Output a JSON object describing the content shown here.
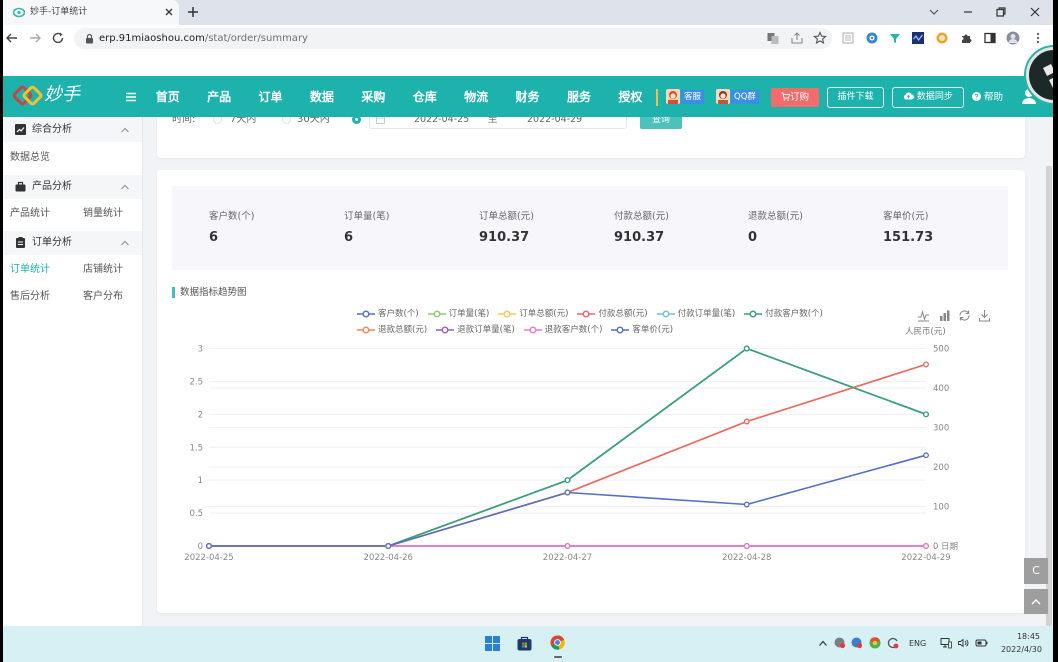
{
  "browser": {
    "tab_title": "妙手-订单统计",
    "url_host": "erp.91miaoshou.com",
    "url_path": "/stat/order/summary"
  },
  "colors": {
    "brand": "#1db3ac",
    "order_button": "#f26c6c",
    "chip_blue": "#3a8ee6",
    "nav_separator": "#e8c15a",
    "active_sidebar_item": "#1db3ac"
  },
  "nav": {
    "logo_text": "妙手",
    "items": [
      "首页",
      "产品",
      "订单",
      "数据",
      "采购",
      "仓库",
      "物流",
      "财务",
      "服务",
      "授权"
    ],
    "service_label": "客服",
    "qq_group_label": "QQ群",
    "order_label": "订购",
    "plugin_download_label": "插件下载",
    "data_sync_label": "数据同步",
    "help_label": "帮助"
  },
  "sidebar": {
    "sections": [
      {
        "title": "综合分析",
        "items": [
          "数据总览"
        ]
      },
      {
        "title": "产品分析",
        "items": [
          "产品统计",
          "销量统计"
        ]
      },
      {
        "title": "订单分析",
        "items": [
          "订单统计",
          "店铺统计",
          "售后分析",
          "客户分布"
        ]
      }
    ],
    "active_item": "订单统计"
  },
  "filter": {
    "time_label": "时间:",
    "options": [
      "7天内",
      "30天内"
    ],
    "selected": "custom-range",
    "start_date": "2022-04-25",
    "range_separator": "至",
    "end_date": "2022-04-29",
    "query_label": "查询"
  },
  "stats": [
    {
      "label": "客户数(个)",
      "value": "6"
    },
    {
      "label": "订单量(笔)",
      "value": "6"
    },
    {
      "label": "订单总额(元)",
      "value": "910.37"
    },
    {
      "label": "付款总额(元)",
      "value": "910.37"
    },
    {
      "label": "退款总额(元)",
      "value": "0"
    },
    {
      "label": "客单价(元)",
      "value": "151.73"
    }
  ],
  "chart_toolbox": [
    "line-chart-icon",
    "bar-chart-icon",
    "restore-icon",
    "download-icon"
  ],
  "chart_data": {
    "type": "line",
    "title": "数据指标趋势图",
    "categories": [
      "2022-04-25",
      "2022-04-26",
      "2022-04-27",
      "2022-04-28",
      "2022-04-29"
    ],
    "xlabel": "日期",
    "ylabel": "",
    "y2label": "人民币(元)",
    "ylim": [
      0,
      3
    ],
    "y2lim": [
      0,
      500
    ],
    "yticks": [
      0,
      0.5,
      1,
      1.5,
      2,
      2.5,
      3
    ],
    "y2ticks": [
      0,
      100,
      200,
      300,
      400,
      500
    ],
    "grid": true,
    "legend": "top-center",
    "series": [
      {
        "name": "客户数(个)",
        "axis": "left",
        "color": "#5470c6",
        "values": [
          0,
          0,
          1,
          3,
          2
        ]
      },
      {
        "name": "订单量(笔)",
        "axis": "left",
        "color": "#91cc75",
        "values": [
          0,
          0,
          1,
          3,
          2
        ]
      },
      {
        "name": "订单总额(元)",
        "axis": "right",
        "color": "#fac858",
        "values": [
          0,
          0,
          135.5,
          315.2,
          459.67
        ]
      },
      {
        "name": "付款总额(元)",
        "axis": "right",
        "color": "#ee6666",
        "values": [
          0,
          0,
          135.5,
          315.2,
          459.67
        ]
      },
      {
        "name": "付款订单量(笔)",
        "axis": "left",
        "color": "#73c0de",
        "values": [
          0,
          0,
          1,
          3,
          2
        ]
      },
      {
        "name": "付款客户数(个)",
        "axis": "left",
        "color": "#3ba272",
        "values": [
          0,
          0,
          1,
          3,
          2
        ]
      },
      {
        "name": "退款总额(元)",
        "axis": "right",
        "color": "#fc8452",
        "values": [
          0,
          0,
          0,
          0,
          0
        ]
      },
      {
        "name": "退款订单量(笔)",
        "axis": "left",
        "color": "#9a60b4",
        "values": [
          0,
          0,
          0,
          0,
          0
        ]
      },
      {
        "name": "退款客户数(个)",
        "axis": "left",
        "color": "#ea7ccc",
        "values": [
          0,
          0,
          0,
          0,
          0
        ]
      },
      {
        "name": "客单价(元)",
        "axis": "right",
        "color": "#5470c6",
        "values": [
          0,
          0,
          135.5,
          105.07,
          229.84
        ]
      }
    ]
  },
  "floating": {
    "service_button_label": "C"
  },
  "taskbar": {
    "language": "ENG",
    "time": "18:45",
    "date": "2022/4/30"
  }
}
